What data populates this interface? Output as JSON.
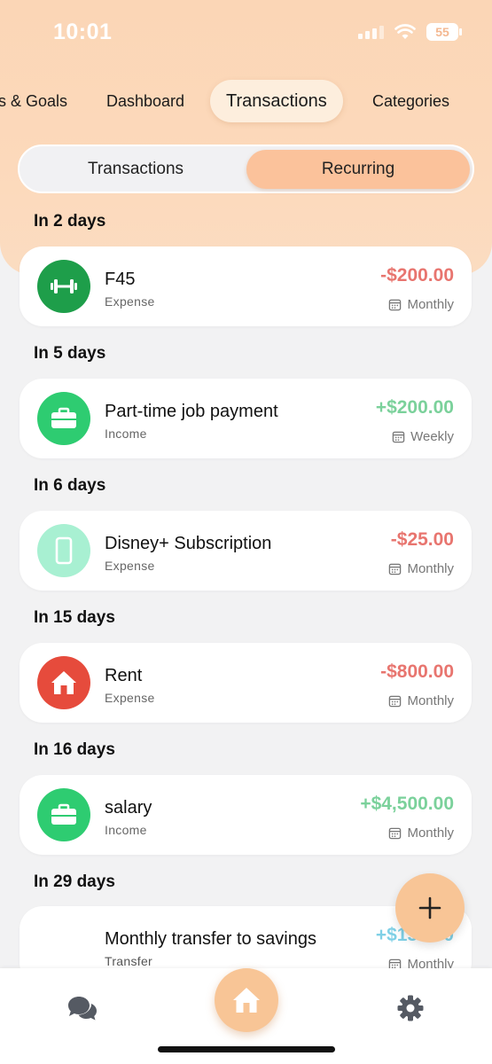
{
  "status": {
    "time": "10:01",
    "battery": "55"
  },
  "top_tabs": [
    {
      "label": "s & Goals"
    },
    {
      "label": "Dashboard"
    },
    {
      "label": "Transactions"
    },
    {
      "label": "Categories"
    }
  ],
  "segmented": {
    "left": "Transactions",
    "right": "Recurring"
  },
  "sections": [
    {
      "header": "In 2 days",
      "title": "F45",
      "type": "Expense",
      "amount": "-$200.00",
      "frequency": "Monthly",
      "icon": "dumbbell-icon",
      "icon_color": "#1e9e4a",
      "amount_color": "#e8756f"
    },
    {
      "header": "In 5 days",
      "title": "Part-time job payment",
      "type": "Income",
      "amount": "+$200.00",
      "frequency": "Weekly",
      "icon": "briefcase-icon",
      "icon_color": "#2ecc71",
      "amount_color": "#7bd19b"
    },
    {
      "header": "In 6 days",
      "title": "Disney+ Subscription",
      "type": "Expense",
      "amount": "-$25.00",
      "frequency": "Monthly",
      "icon": "phone-icon",
      "icon_color": "#a8f0d2",
      "amount_color": "#e8756f"
    },
    {
      "header": "In 15 days",
      "title": "Rent",
      "type": "Expense",
      "amount": "-$800.00",
      "frequency": "Monthly",
      "icon": "house-icon",
      "icon_color": "#e64b3c",
      "amount_color": "#e8756f"
    },
    {
      "header": "In 16 days",
      "title": "salary",
      "type": "Income",
      "amount": "+$4,500.00",
      "frequency": "Monthly",
      "icon": "briefcase-icon",
      "icon_color": "#2ecc71",
      "amount_color": "#7bd19b"
    },
    {
      "header": "In 29 days",
      "title": "Monthly transfer to savings",
      "type": "Transfer",
      "amount": "+$150.00",
      "frequency": "Monthly",
      "icon": "none",
      "icon_color": "#ffffff",
      "amount_color": "#7fd0e6"
    }
  ],
  "fab": {
    "icon": "plus-icon"
  },
  "bottom_nav": {
    "left_icon": "chat-icon",
    "center_icon": "home-icon",
    "right_icon": "gear-icon"
  }
}
